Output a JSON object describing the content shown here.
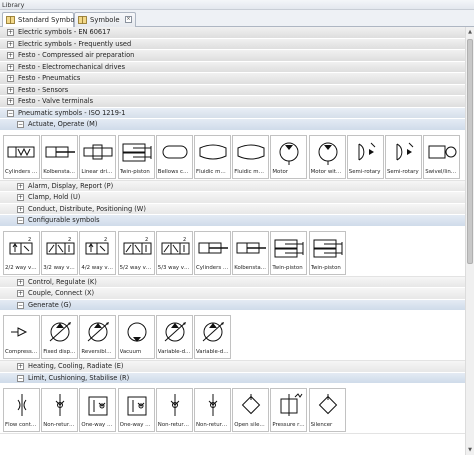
{
  "window": {
    "title": "Library"
  },
  "tabs": [
    {
      "label": "Standard Symbols",
      "active": true
    },
    {
      "label": "Symbole",
      "active": false
    }
  ],
  "tree": [
    {
      "label": "Electric symbols - EN 60617",
      "level": 1,
      "expanded": false
    },
    {
      "label": "Electric symbols - Frequently used",
      "level": 1,
      "expanded": false
    },
    {
      "label": "Festo - Compressed air preparation",
      "level": 1,
      "expanded": false
    },
    {
      "label": "Festo - Electromechanical drives",
      "level": 1,
      "expanded": false
    },
    {
      "label": "Festo - Pneumatics",
      "level": 1,
      "expanded": false
    },
    {
      "label": "Festo - Sensors",
      "level": 1,
      "expanded": false
    },
    {
      "label": "Festo - Valve terminals",
      "level": 1,
      "expanded": false
    },
    {
      "label": "Pneumatic symbols - ISO 1219-1",
      "level": 1,
      "expanded": true
    },
    {
      "label": "Actuate, Operate (M)",
      "level": 2,
      "expanded": true,
      "symbols": [
        {
          "label": "Cylinders wi...",
          "icon": "cylinder-single"
        },
        {
          "label": "Kolbenstan...",
          "icon": "cylinder-rod"
        },
        {
          "label": "Linear drive...",
          "icon": "linear-drive"
        },
        {
          "label": "Twin-piston",
          "icon": "twin-piston"
        },
        {
          "label": "Bellows cyli...",
          "icon": "bellows"
        },
        {
          "label": "Fluidic muscle",
          "icon": "fluidic-muscle"
        },
        {
          "label": "Fluidic muscle",
          "icon": "fluidic-muscle"
        },
        {
          "label": "Motor",
          "icon": "motor"
        },
        {
          "label": "Motor with a...",
          "icon": "motor"
        },
        {
          "label": "Semi-rotary",
          "icon": "semi-rotary"
        },
        {
          "label": "Semi-rotary",
          "icon": "semi-rotary"
        },
        {
          "label": "Swivel/linea...",
          "icon": "swivel"
        }
      ]
    },
    {
      "label": "Alarm, Display, Report (P)",
      "level": 2,
      "expanded": false
    },
    {
      "label": "Clamp, Hold (U)",
      "level": 2,
      "expanded": false
    },
    {
      "label": "Conduct, Distribute, Positioning (W)",
      "level": 2,
      "expanded": false
    },
    {
      "label": "Configurable symbols",
      "level": 2,
      "expanded": true,
      "symbols": [
        {
          "label": "2/2 way valv...",
          "icon": "valve-2"
        },
        {
          "label": "3/2 way valv...",
          "icon": "valve-3"
        },
        {
          "label": "4/2 way valv...",
          "icon": "valve-2"
        },
        {
          "label": "5/2 way valv...",
          "icon": "valve-3"
        },
        {
          "label": "5/3 way valv...",
          "icon": "valve-3"
        },
        {
          "label": "Cylinders wi...",
          "icon": "cylinder-rod"
        },
        {
          "label": "Kolbenstan...",
          "icon": "cylinder-rod"
        },
        {
          "label": "Twin-piston",
          "icon": "twin-piston"
        },
        {
          "label": "Twin-piston",
          "icon": "twin-piston"
        }
      ]
    },
    {
      "label": "Control, Regulate (K)",
      "level": 2,
      "expanded": false
    },
    {
      "label": "Couple, Connect (X)",
      "level": 2,
      "expanded": false
    },
    {
      "label": "Generate (G)",
      "level": 2,
      "expanded": true,
      "symbols": [
        {
          "label": "Compresse...",
          "icon": "compressor"
        },
        {
          "label": "Fixed displa...",
          "icon": "pump"
        },
        {
          "label": "Reversible ...",
          "icon": "pump"
        },
        {
          "label": "Vacuum",
          "icon": "vacuum"
        },
        {
          "label": "Variable-dis...",
          "icon": "pump"
        },
        {
          "label": "Variable-dis...",
          "icon": "pump"
        }
      ]
    },
    {
      "label": "Heating, Cooling, Radiate (E)",
      "level": 2,
      "expanded": false
    },
    {
      "label": "Limit, Cushioning, Stabilise (R)",
      "level": 2,
      "expanded": true,
      "symbols": [
        {
          "label": "Flow control...",
          "icon": "flow-control"
        },
        {
          "label": "Non-return ...",
          "icon": "non-return"
        },
        {
          "label": "One-way flo...",
          "icon": "one-way"
        },
        {
          "label": "One-way flo...",
          "icon": "one-way"
        },
        {
          "label": "Non-return ...",
          "icon": "non-return"
        },
        {
          "label": "Non-return ...",
          "icon": "non-return"
        },
        {
          "label": "Open silencer",
          "icon": "silencer"
        },
        {
          "label": "Pressure re...",
          "icon": "pressure-regulator"
        },
        {
          "label": "Silencer",
          "icon": "silencer"
        }
      ]
    }
  ]
}
